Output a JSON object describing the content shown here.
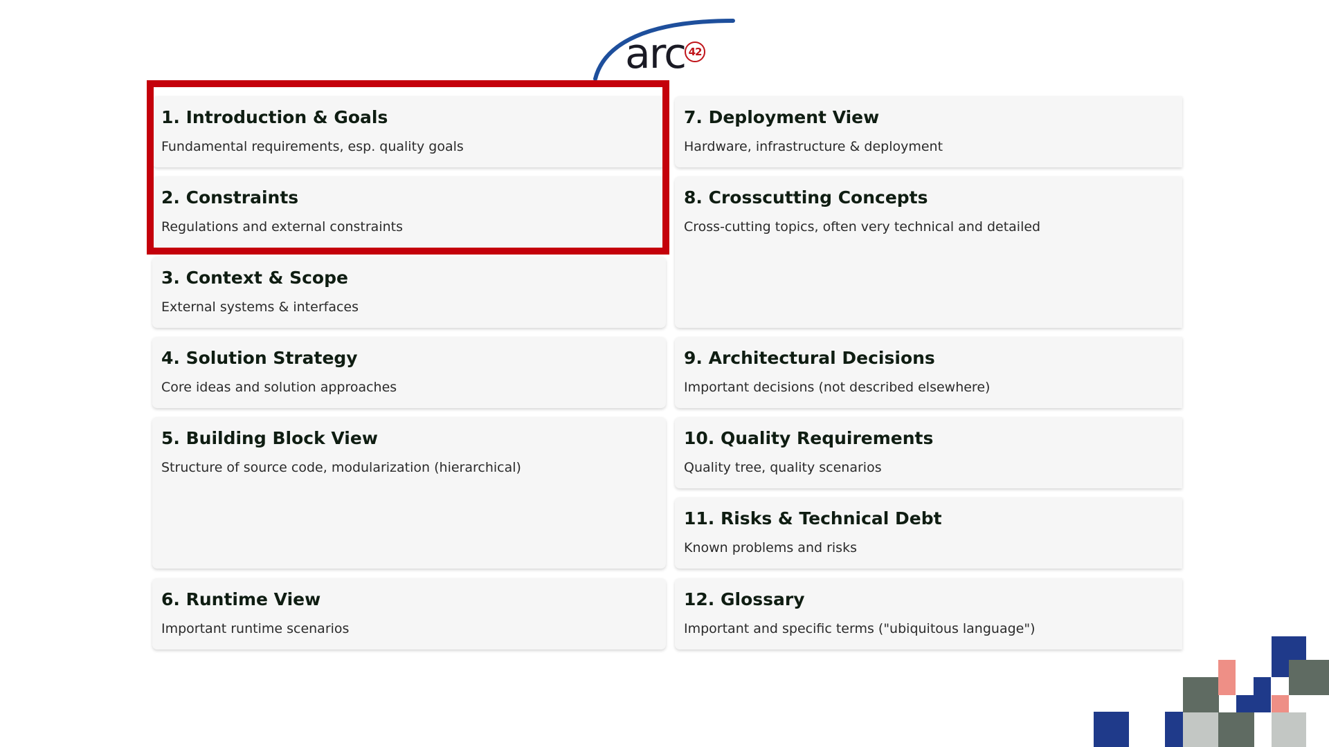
{
  "logo": {
    "wordmark": "arc",
    "badge": "42",
    "colors": {
      "arc": "#1e4f9c",
      "badge": "#c0141a"
    }
  },
  "sections": [
    {
      "number": "1.",
      "title": "Introduction & Goals",
      "label": "1. Introduction & Goals",
      "description": "Fundamental requirements, esp. quality goals"
    },
    {
      "number": "2.",
      "title": "Constraints",
      "label": "2. Constraints",
      "description": "Regulations and external constraints"
    },
    {
      "number": "3.",
      "title": "Context & Scope",
      "label": "3. Context & Scope",
      "description": "External systems & interfaces"
    },
    {
      "number": "4.",
      "title": "Solution Strategy",
      "label": "4. Solution Strategy",
      "description": "Core ideas and solution approaches"
    },
    {
      "number": "5.",
      "title": "Building Block View",
      "label": "5. Building Block View",
      "description": "Structure of source code, modularization (hierarchical)"
    },
    {
      "number": "6.",
      "title": "Runtime View",
      "label": "6. Runtime View",
      "description": "Important runtime scenarios"
    },
    {
      "number": "7.",
      "title": "Deployment View",
      "label": "7. Deployment View",
      "description": "Hardware, infrastructure & deployment"
    },
    {
      "number": "8.",
      "title": "Crosscutting Concepts",
      "label": "8. Crosscutting Concepts",
      "description": "Cross-cutting topics, often very technical and detailed"
    },
    {
      "number": "9.",
      "title": "Architectural Decisions",
      "label": "9. Architectural Decisions",
      "description": "Important decisions (not described elsewhere)"
    },
    {
      "number": "10.",
      "title": "Quality Requirements",
      "label": "10. Quality Requirements",
      "description": "Quality tree, quality scenarios"
    },
    {
      "number": "11.",
      "title": "Risks & Technical Debt",
      "label": "11. Risks & Technical Debt",
      "description": "Known problems and risks"
    },
    {
      "number": "12.",
      "title": "Glossary",
      "label": "12. Glossary",
      "description": "Important and specific terms (\"ubiquitous language\")"
    }
  ],
  "highlight": {
    "sections": [
      "1.",
      "2."
    ],
    "color": "#c4000b"
  },
  "colors": {
    "card_background": "#f6f6f6",
    "title_text": "#0f1d12",
    "mosaic": [
      "#1f3a8a",
      "#5f6b62",
      "#ee8f86",
      "#c3c7c4"
    ]
  }
}
